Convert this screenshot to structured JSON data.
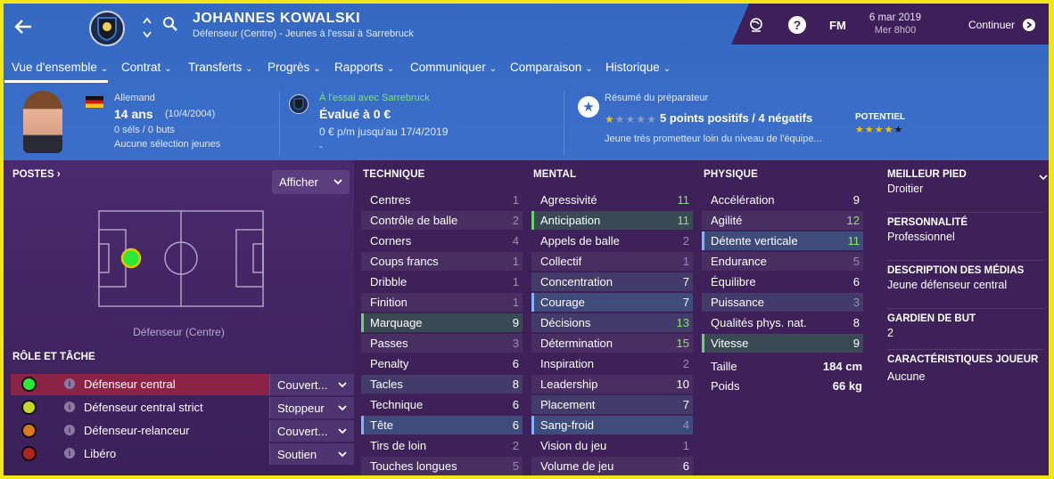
{
  "header": {
    "player_name": "JOHANNES KOWALSKI",
    "subtitle": "Défenseur (Centre) - Jeunes à l'essai à Sarrebruck",
    "fm_label": "FM",
    "date": "6 mar 2019",
    "day_time": "Mer 8h00",
    "continue_label": "Continuer"
  },
  "tabs": [
    "Vue d'ensemble",
    "Contrat",
    "Transferts",
    "Progrès",
    "Rapports",
    "Communiquer",
    "Comparaison",
    "Historique"
  ],
  "profile": {
    "nationality": "Allemand",
    "age": "14 ans",
    "dob": "(10/4/2004)",
    "caps": "0 séls / 0 buts",
    "youth_selection": "Aucune sélection jeunes",
    "trial_status": "À l'essai avec Sarrebruck",
    "value": "Évalué à 0 €",
    "wage": "0 € p/m jusqu'au 17/4/2019",
    "dash": "-",
    "coach_summary_title": "Résumé du préparateur",
    "coach_rating": "5 points positifs / 4 négatifs",
    "potential_label": "POTENTIEL",
    "coach_note": "Jeune très prometteur loin du niveau de l'équipe...",
    "coach_stars": 1,
    "potential_stars": 4
  },
  "positions": {
    "title": "POSTES",
    "show_button": "Afficher",
    "position_label": "Défenseur (Centre)"
  },
  "roles": {
    "title": "RÔLE ET TÂCHE",
    "items": [
      {
        "name": "Défenseur central",
        "duty": "Couvert...",
        "color": "#2ee836"
      },
      {
        "name": "Défenseur central strict",
        "duty": "Stoppeur",
        "color": "#c7d62a"
      },
      {
        "name": "Défenseur-relanceur",
        "duty": "Couvert...",
        "color": "#d87a1e"
      },
      {
        "name": "Libéro",
        "duty": "Soutien",
        "color": "#b0231f"
      }
    ]
  },
  "attributes": {
    "technique": {
      "title": "TECHNIQUE",
      "rows": [
        {
          "name": "Centres",
          "value": "1"
        },
        {
          "name": "Contrôle de balle",
          "value": "2"
        },
        {
          "name": "Corners",
          "value": "4"
        },
        {
          "name": "Coups francs",
          "value": "1"
        },
        {
          "name": "Dribble",
          "value": "1"
        },
        {
          "name": "Finition",
          "value": "1"
        },
        {
          "name": "Marquage",
          "value": "9"
        },
        {
          "name": "Passes",
          "value": "3"
        },
        {
          "name": "Penalty",
          "value": "6"
        },
        {
          "name": "Tacles",
          "value": "8"
        },
        {
          "name": "Technique",
          "value": "6"
        },
        {
          "name": "Tête",
          "value": "6"
        },
        {
          "name": "Tirs de loin",
          "value": "2"
        },
        {
          "name": "Touches longues",
          "value": "5"
        }
      ]
    },
    "mental": {
      "title": "MENTAL",
      "rows": [
        {
          "name": "Agressivité",
          "value": "11"
        },
        {
          "name": "Anticipation",
          "value": "11"
        },
        {
          "name": "Appels de balle",
          "value": "2"
        },
        {
          "name": "Collectif",
          "value": "1"
        },
        {
          "name": "Concentration",
          "value": "7"
        },
        {
          "name": "Courage",
          "value": "7"
        },
        {
          "name": "Décisions",
          "value": "13"
        },
        {
          "name": "Détermination",
          "value": "15"
        },
        {
          "name": "Inspiration",
          "value": "2"
        },
        {
          "name": "Leadership",
          "value": "10"
        },
        {
          "name": "Placement",
          "value": "7"
        },
        {
          "name": "Sang-froid",
          "value": "4"
        },
        {
          "name": "Vision du jeu",
          "value": "1"
        },
        {
          "name": "Volume de jeu",
          "value": "6"
        }
      ]
    },
    "physique": {
      "title": "PHYSIQUE",
      "rows": [
        {
          "name": "Accélération",
          "value": "9"
        },
        {
          "name": "Agilité",
          "value": "12"
        },
        {
          "name": "Détente verticale",
          "value": "11"
        },
        {
          "name": "Endurance",
          "value": "5"
        },
        {
          "name": "Équilibre",
          "value": "6"
        },
        {
          "name": "Puissance",
          "value": "3"
        },
        {
          "name": "Qualités phys. nat.",
          "value": "8"
        },
        {
          "name": "Vitesse",
          "value": "9"
        }
      ],
      "height_label": "Taille",
      "height": "184 cm",
      "weight_label": "Poids",
      "weight": "66 kg"
    }
  },
  "info": {
    "best_foot_label": "MEILLEUR PIED",
    "best_foot": "Droitier",
    "personality_label": "PERSONNALITÉ",
    "personality": "Professionnel",
    "media_label": "DESCRIPTION DES MÉDIAS",
    "media": "Jeune défenseur central",
    "goalkeeper_label": "GARDIEN DE BUT",
    "goalkeeper": "2",
    "traits_label": "CARACTÉRISTIQUES JOUEUR",
    "traits": "Aucune"
  }
}
